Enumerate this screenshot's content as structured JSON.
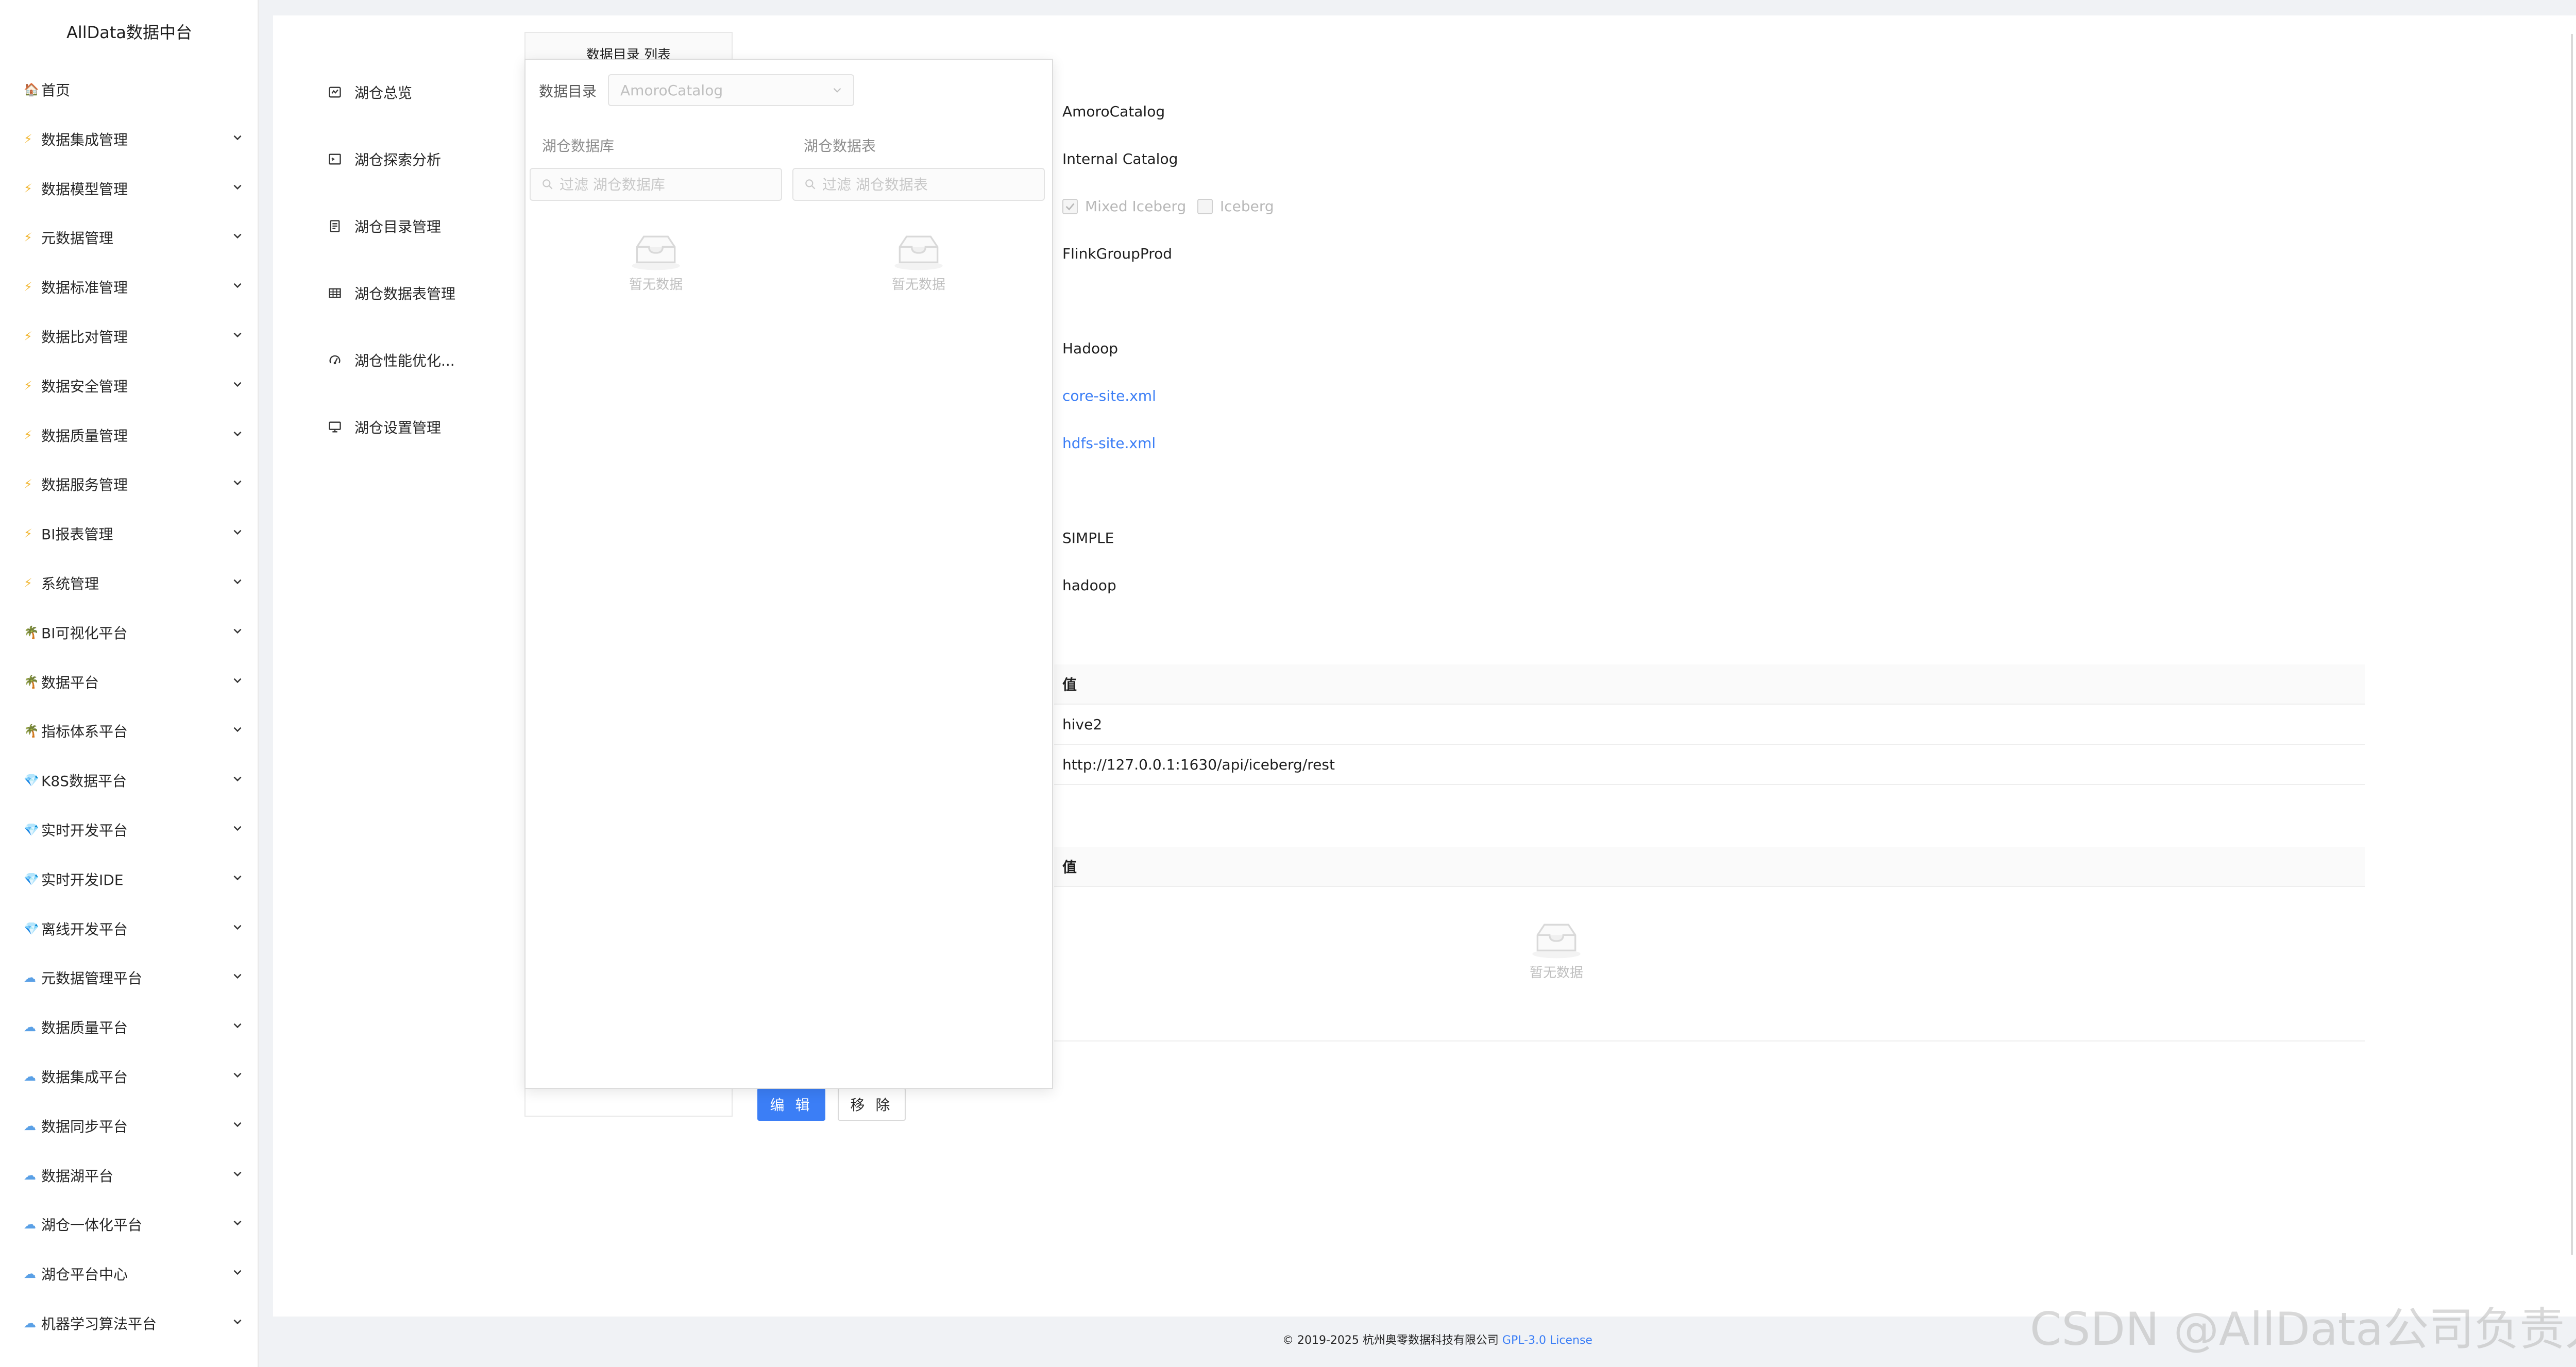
{
  "app": {
    "brand": "AllData数据中台"
  },
  "sidebar": {
    "items": [
      {
        "label": "首页",
        "icon": "home-icon",
        "glyph": "🏠",
        "color": "#e8a33d",
        "chevron": false
      },
      {
        "label": "数据集成管理",
        "icon": "bolt-icon",
        "glyph": "⚡",
        "color": "#f2b630",
        "chevron": true
      },
      {
        "label": "数据模型管理",
        "icon": "bolt-icon",
        "glyph": "⚡",
        "color": "#f2b630",
        "chevron": true
      },
      {
        "label": "元数据管理",
        "icon": "bolt-icon",
        "glyph": "⚡",
        "color": "#f2b630",
        "chevron": true
      },
      {
        "label": "数据标准管理",
        "icon": "bolt-icon",
        "glyph": "⚡",
        "color": "#f2b630",
        "chevron": true
      },
      {
        "label": "数据比对管理",
        "icon": "bolt-icon",
        "glyph": "⚡",
        "color": "#f2b630",
        "chevron": true
      },
      {
        "label": "数据安全管理",
        "icon": "bolt-icon",
        "glyph": "⚡",
        "color": "#f2b630",
        "chevron": true
      },
      {
        "label": "数据质量管理",
        "icon": "bolt-icon",
        "glyph": "⚡",
        "color": "#f2b630",
        "chevron": true
      },
      {
        "label": "数据服务管理",
        "icon": "bolt-icon",
        "glyph": "⚡",
        "color": "#f2b630",
        "chevron": true
      },
      {
        "label": "BI报表管理",
        "icon": "bolt-icon",
        "glyph": "⚡",
        "color": "#f2b630",
        "chevron": true
      },
      {
        "label": "系统管理",
        "icon": "bolt-icon",
        "glyph": "⚡",
        "color": "#f2b630",
        "chevron": true
      },
      {
        "label": "BI可视化平台",
        "icon": "palm-tree-icon",
        "glyph": "🌴",
        "color": "#4caf50",
        "chevron": true
      },
      {
        "label": "数据平台",
        "icon": "palm-tree-icon",
        "glyph": "🌴",
        "color": "#4caf50",
        "chevron": true
      },
      {
        "label": "指标体系平台",
        "icon": "palm-tree-icon",
        "glyph": "🌴",
        "color": "#4caf50",
        "chevron": true
      },
      {
        "label": "K8S数据平台",
        "icon": "gem-icon",
        "glyph": "💎",
        "color": "#3b8ef0",
        "chevron": true
      },
      {
        "label": "实时开发平台",
        "icon": "gem-icon",
        "glyph": "💎",
        "color": "#3b8ef0",
        "chevron": true
      },
      {
        "label": "实时开发IDE",
        "icon": "gem-icon",
        "glyph": "💎",
        "color": "#3b8ef0",
        "chevron": true
      },
      {
        "label": "离线开发平台",
        "icon": "gem-icon",
        "glyph": "💎",
        "color": "#3b8ef0",
        "chevron": true
      },
      {
        "label": "元数据管理平台",
        "icon": "cloud-sync-icon",
        "glyph": "☁",
        "color": "#5aa0e6",
        "chevron": true
      },
      {
        "label": "数据质量平台",
        "icon": "cloud-sync-icon",
        "glyph": "☁",
        "color": "#5aa0e6",
        "chevron": true
      },
      {
        "label": "数据集成平台",
        "icon": "cloud-sync-icon",
        "glyph": "☁",
        "color": "#5aa0e6",
        "chevron": true
      },
      {
        "label": "数据同步平台",
        "icon": "cloud-sync-icon",
        "glyph": "☁",
        "color": "#5aa0e6",
        "chevron": true
      },
      {
        "label": "数据湖平台",
        "icon": "cloud-sync-icon",
        "glyph": "☁",
        "color": "#5aa0e6",
        "chevron": true
      },
      {
        "label": "湖仓一体化平台",
        "icon": "cloud-sync-icon",
        "glyph": "☁",
        "color": "#5aa0e6",
        "chevron": true
      },
      {
        "label": "湖仓平台中心",
        "icon": "cloud-sync-icon",
        "glyph": "☁",
        "color": "#5aa0e6",
        "chevron": true
      },
      {
        "label": "机器学习算法平台",
        "icon": "cloud-sync-icon",
        "glyph": "☁",
        "color": "#5aa0e6",
        "chevron": true
      }
    ]
  },
  "submenu": {
    "items": [
      {
        "label": "湖仓总览",
        "icon": "dashboard-icon"
      },
      {
        "label": "湖仓探索分析",
        "icon": "terminal-icon"
      },
      {
        "label": "湖仓目录管理",
        "icon": "catalog-icon"
      },
      {
        "label": "湖仓数据表管理",
        "icon": "table-icon"
      },
      {
        "label": "湖仓性能优化...",
        "icon": "optimize-icon"
      },
      {
        "label": "湖仓设置管理",
        "icon": "monitor-icon"
      }
    ]
  },
  "tab_header": {
    "label": "数据目录 列表"
  },
  "details": {
    "catalog_name": "AmoroCatalog",
    "catalog_type": "Internal Catalog",
    "table_formats": [
      {
        "label": "Mixed Iceberg",
        "checked": true
      },
      {
        "label": "Iceberg",
        "checked": false
      }
    ],
    "optimizer_group": "FlinkGroupProd",
    "storage_type": "Hadoop",
    "core_site": "core-site.xml",
    "hdfs_site": "hdfs-site.xml",
    "auth_type": "SIMPLE",
    "hadoop_user": "hadoop"
  },
  "properties_table": {
    "header_value": "值",
    "rows": [
      "hive2",
      "http://127.0.0.1:1630/api/iceberg/rest"
    ]
  },
  "table_properties_table": {
    "header_value": "值",
    "empty_text": "暂无数据"
  },
  "actions": {
    "edit_label": "编 辑",
    "remove_label": "移 除"
  },
  "popover": {
    "catalog_label": "数据目录",
    "catalog_select_value": "AmoroCatalog",
    "database_title": "湖仓数据库",
    "table_title": "湖仓数据表",
    "database_filter_placeholder": "过滤 湖仓数据库",
    "table_filter_placeholder": "过滤 湖仓数据表",
    "database_empty": "暂无数据",
    "table_empty": "暂无数据"
  },
  "footer": {
    "copyright": "© 2019-2025 杭州奥零数据科技有限公司",
    "license_link": "GPL-3.0 License"
  },
  "watermark": "CSDN @AllData公司负责人",
  "colors": {
    "accent": "#3b7ef6",
    "sidebar_bg": "#ffffff",
    "page_bg": "#f0f2f5"
  }
}
